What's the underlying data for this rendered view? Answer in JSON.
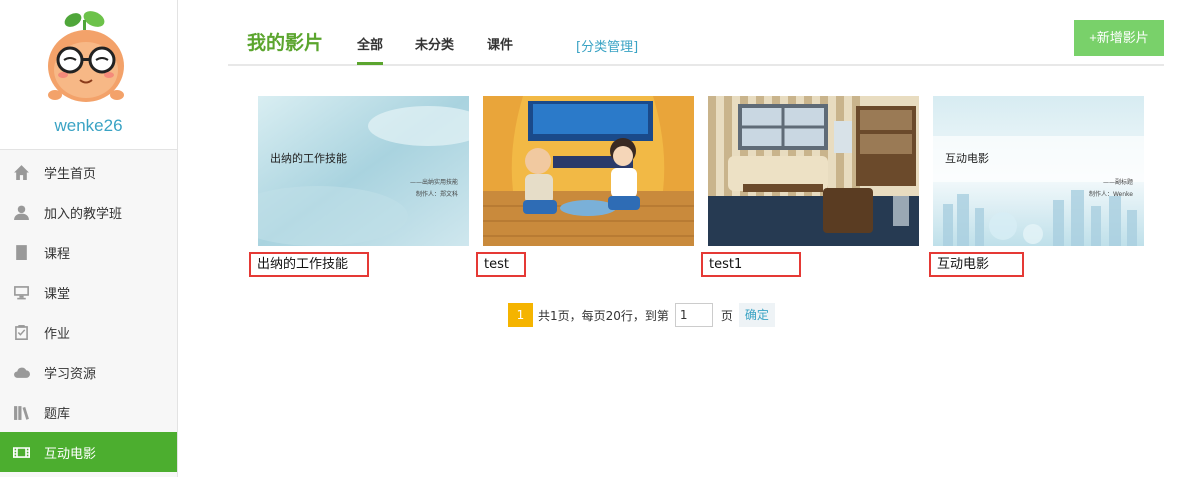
{
  "user": {
    "name": "wenke26"
  },
  "sidebar": {
    "items": [
      {
        "label": "学生首页",
        "icon": "home-icon"
      },
      {
        "label": "加入的教学班",
        "icon": "user-group-icon"
      },
      {
        "label": "课程",
        "icon": "book-icon"
      },
      {
        "label": "课堂",
        "icon": "monitor-icon"
      },
      {
        "label": "作业",
        "icon": "clipboard-check-icon"
      },
      {
        "label": "学习资源",
        "icon": "cloud-icon"
      },
      {
        "label": "题库",
        "icon": "books-shelf-icon"
      },
      {
        "label": "互动电影",
        "icon": "film-icon",
        "active": true
      }
    ]
  },
  "header": {
    "title": "我的影片",
    "tabs": [
      {
        "label": "全部",
        "active": true
      },
      {
        "label": "未分类"
      },
      {
        "label": "课件"
      }
    ],
    "manage_link": "[分类管理]",
    "add_button": "+新增影片"
  },
  "movies": [
    {
      "title": "出纳的工作技能",
      "thumb_title": "出纳的工作技能",
      "thumb_sub": "——出纳实用技能",
      "thumb_author": "制作人：郑文科"
    },
    {
      "title": "test"
    },
    {
      "title": "test1"
    },
    {
      "title": "互动电影",
      "thumb_title": "互动电影",
      "thumb_sub": "——副标题",
      "thumb_author": "制作人：Wenke"
    }
  ],
  "pager": {
    "current": "1",
    "summary": "共1页，每页20行，到第",
    "input_value": "1",
    "unit": "页",
    "ok": "确定"
  },
  "colors": {
    "accent": "#4cae2f",
    "title_green": "#5ba52e",
    "link_blue": "#3aa3c4",
    "highlight_red": "#e53935",
    "pager_yellow": "#f5b400"
  }
}
